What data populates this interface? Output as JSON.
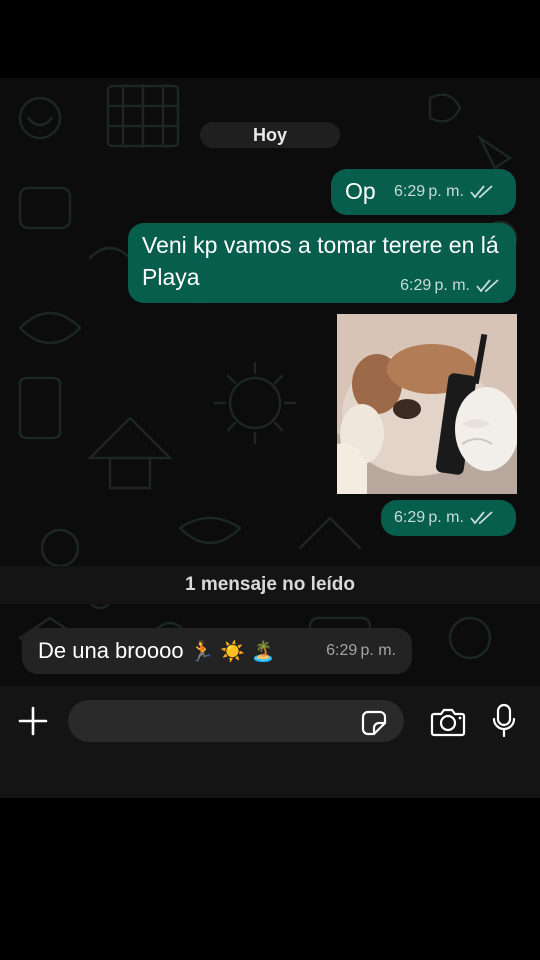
{
  "chat": {
    "date_label": "Hoy",
    "messages_out": [
      {
        "text": "Op",
        "time": "6:29 p. m."
      },
      {
        "text": "Veni kp vamos a tomar terere en lá Playa",
        "time": "6:29 p. m."
      },
      {
        "type": "image",
        "image_desc": "dog-holding-phone-sticker",
        "time": "6:29 p. m."
      }
    ],
    "unread_divider": "1 mensaje no leído",
    "message_in": {
      "text": "De una broooo",
      "emojis": "🏃 ☀️ 🏝️",
      "time": "6:29 p. m."
    }
  },
  "input_bar": {
    "placeholder": "",
    "icons": [
      "plus-icon",
      "sticker-icon",
      "camera-icon",
      "microphone-icon"
    ]
  },
  "colors": {
    "outgoing_bubble": "#075e4d",
    "incoming_bubble": "#232323",
    "background": "#0b0c0b"
  }
}
